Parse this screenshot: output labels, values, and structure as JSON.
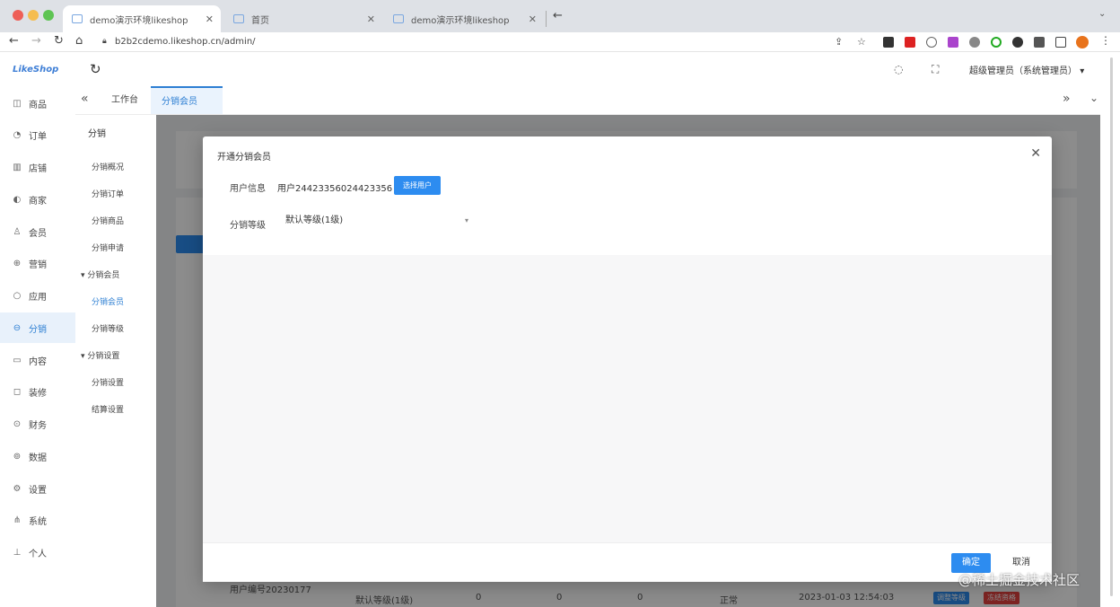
{
  "browser": {
    "tabs": [
      {
        "label": "demo演示环境likeshop",
        "active": true
      },
      {
        "label": "首页",
        "active": false
      },
      {
        "label": "demo演示环境likeshop",
        "active": false
      }
    ],
    "url": "b2b2cdemo.likeshop.cn/admin/"
  },
  "header": {
    "logo": "LikeShop",
    "admin_label": "超级管理员（系统管理员）"
  },
  "sidebar": {
    "items": [
      {
        "label": "商品",
        "icon": "bag-icon"
      },
      {
        "label": "订单",
        "icon": "bell-icon"
      },
      {
        "label": "店铺",
        "icon": "store-icon"
      },
      {
        "label": "商家",
        "icon": "merchant-icon"
      },
      {
        "label": "会员",
        "icon": "user-icon"
      },
      {
        "label": "营销",
        "icon": "gift-icon"
      },
      {
        "label": "应用",
        "icon": "app-icon"
      },
      {
        "label": "分销",
        "icon": "share-icon",
        "active": true
      },
      {
        "label": "内容",
        "icon": "book-icon"
      },
      {
        "label": "装修",
        "icon": "paint-icon"
      },
      {
        "label": "财务",
        "icon": "finance-icon"
      },
      {
        "label": "数据",
        "icon": "chart-icon"
      },
      {
        "label": "设置",
        "icon": "gear-icon"
      },
      {
        "label": "系统",
        "icon": "system-icon"
      },
      {
        "label": "个人",
        "icon": "person-icon"
      }
    ]
  },
  "page_tabs": {
    "workbench": "工作台",
    "current": "分销会员"
  },
  "submenu": {
    "title": "分销",
    "items": [
      {
        "label": "分销概况"
      },
      {
        "label": "分销订单"
      },
      {
        "label": "分销商品"
      },
      {
        "label": "分销申请"
      },
      {
        "label": "分销会员",
        "group": true
      },
      {
        "label": "分销会员",
        "active": true
      },
      {
        "label": "分销等级"
      },
      {
        "label": "分销设置",
        "group": true
      },
      {
        "label": "分销设置"
      },
      {
        "label": "结算设置"
      }
    ]
  },
  "background": {
    "user_no": "用户编号20230177",
    "level": "默认等级(1级)",
    "col1": "0",
    "col2": "0",
    "col3": "0",
    "status": "正常",
    "date": "2023-01-03 12:54:03",
    "btn1": "调整等级",
    "btn2": "冻结资格"
  },
  "modal": {
    "title": "开通分销会员",
    "user_label": "用户信息",
    "user_value": "用户24423356024423356",
    "select_user_btn": "选择用户",
    "level_label": "分销等级",
    "level_value": "默认等级(1级)",
    "ok": "确定",
    "cancel": "取消"
  },
  "watermark": "@稀土掘金技术社区",
  "colors": {
    "accent": "#2d8cf0",
    "danger": "#e64340"
  }
}
